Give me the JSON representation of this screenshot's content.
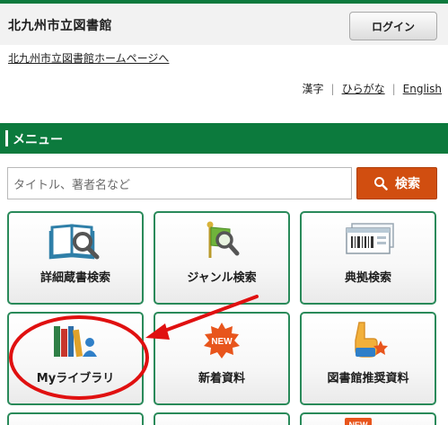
{
  "header": {
    "title": "北九州市立図書館",
    "login_label": "ログイン"
  },
  "home_link": "北九州市立図書館ホームページへ",
  "languages": {
    "kanji": "漢字",
    "hiragana": "ひらがな",
    "english": "English"
  },
  "menu": {
    "title": "メニュー"
  },
  "search": {
    "placeholder": "タイトル、著者名など",
    "button_label": "検索"
  },
  "tiles": [
    {
      "label": "詳細蔵書検索",
      "icon": "book-search-icon"
    },
    {
      "label": "ジャンル検索",
      "icon": "genre-flag-search-icon"
    },
    {
      "label": "典拠検索",
      "icon": "barcode-card-icon"
    },
    {
      "label": "Myライブラリ",
      "icon": "my-library-books-icon"
    },
    {
      "label": "新着資料",
      "icon": "new-badge-icon"
    },
    {
      "label": "図書館推奨資料",
      "icon": "recommend-hand-star-icon"
    }
  ],
  "annotation": {
    "circle_color": "#e01010",
    "arrow_color": "#e01010"
  },
  "colors": {
    "brand_green": "#0c7a3d",
    "search_orange": "#d14e10",
    "tile_border": "#2a8a5a"
  }
}
